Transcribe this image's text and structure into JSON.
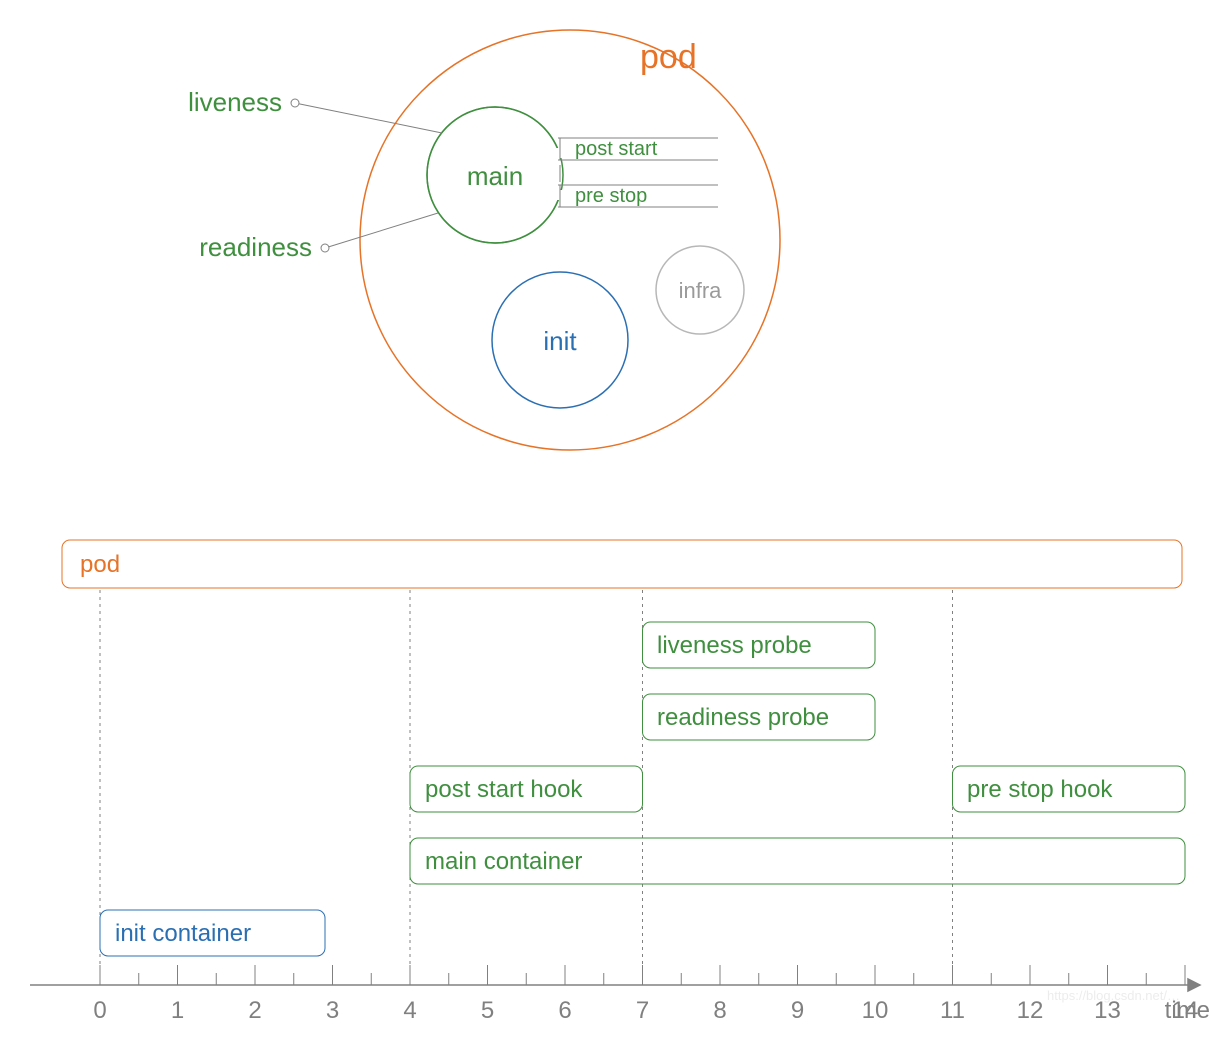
{
  "chart_data": {
    "type": "timeline",
    "x": [
      0,
      1,
      2,
      3,
      4,
      5,
      6,
      7,
      8,
      9,
      10,
      11,
      12,
      13,
      14
    ],
    "xlabel": "time",
    "bars": [
      {
        "name": "pod",
        "start": 0,
        "end": 14.0,
        "color": "orange"
      },
      {
        "name": "liveness probe",
        "start": 7,
        "end": 10,
        "color": "green"
      },
      {
        "name": "readiness probe",
        "start": 7,
        "end": 10,
        "color": "green"
      },
      {
        "name": "post start hook",
        "start": 4,
        "end": 7,
        "color": "green"
      },
      {
        "name": "pre stop hook",
        "start": 11,
        "end": 14,
        "color": "green"
      },
      {
        "name": "main container",
        "start": 4,
        "end": 14,
        "color": "green"
      },
      {
        "name": "init container",
        "start": 0,
        "end": 2,
        "color": "blue"
      }
    ],
    "guides": [
      0,
      4,
      7,
      11
    ]
  },
  "pod": {
    "title": "pod",
    "main": {
      "label": "main",
      "hooks": {
        "post_start": "post start",
        "pre_stop": "pre stop"
      },
      "probes": {
        "liveness": "liveness",
        "readiness": "readiness"
      }
    },
    "init": {
      "label": "init"
    },
    "infra": {
      "label": "infra"
    }
  },
  "timeline": {
    "pod": "pod",
    "liveness": "liveness probe",
    "readiness": "readiness probe",
    "post_start": "post start hook",
    "pre_stop": "pre stop hook",
    "main": "main container",
    "init": "init container",
    "xlabel": "time",
    "ticks": [
      "0",
      "1",
      "2",
      "3",
      "4",
      "5",
      "6",
      "7",
      "8",
      "9",
      "10",
      "11",
      "12",
      "13",
      "14"
    ]
  },
  "colors": {
    "orange": "#e67327",
    "green": "#3f8f3f",
    "blue": "#2b6fb3",
    "grey": "#b7b7b7",
    "axis": "#808080",
    "tick": "#808080",
    "watermark": "#dadada"
  }
}
